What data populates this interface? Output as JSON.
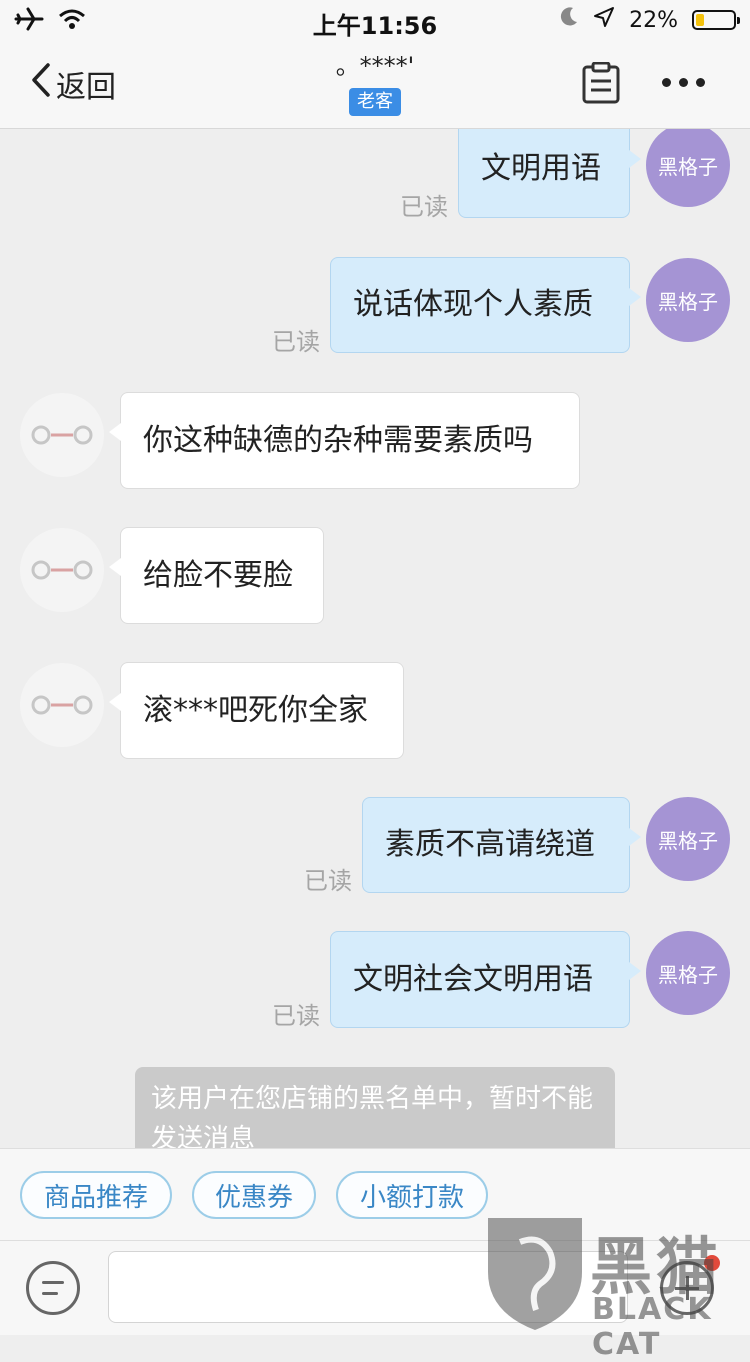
{
  "status_bar": {
    "time": "上午11:56",
    "battery_percent": "22%",
    "battery_level": 0.22,
    "icons": [
      "airplane-icon",
      "wifi-icon",
      "moon-icon",
      "location-icon",
      "battery-icon"
    ]
  },
  "nav": {
    "back_label": "返回",
    "title": "。****'",
    "badge": "老客",
    "icons": [
      "chevron-left-icon",
      "clipboard-icon",
      "more-icon"
    ]
  },
  "messages": [
    {
      "side": "out",
      "text": "文明用语",
      "read": "已读",
      "avatar": "黑格子"
    },
    {
      "side": "out",
      "text": "说话体现个人素质",
      "read": "已读",
      "avatar": "黑格子"
    },
    {
      "side": "in",
      "text": "你这种缺德的杂种需要素质吗"
    },
    {
      "side": "in",
      "text": "给脸不要脸"
    },
    {
      "side": "in",
      "text": "滚***吧死你全家"
    },
    {
      "side": "out",
      "text": "素质不高请绕道",
      "read": "已读",
      "avatar": "黑格子"
    },
    {
      "side": "out",
      "text": "文明社会文明用语",
      "read": "已读",
      "avatar": "黑格子"
    }
  ],
  "system_notice": "该用户在您店铺的黑名单中，暂时不能发送消息",
  "quick_actions": [
    "商品推荐",
    "优惠券",
    "小额打款"
  ],
  "input": {
    "placeholder": ""
  },
  "watermark": {
    "cn": "黑猫",
    "en": "BLACK CAT"
  },
  "colors": {
    "accent": "#3b8de5",
    "bubble_out": "#d6ecfb",
    "avatar_me": "#a594d4",
    "chip_text": "#3a87c6"
  }
}
